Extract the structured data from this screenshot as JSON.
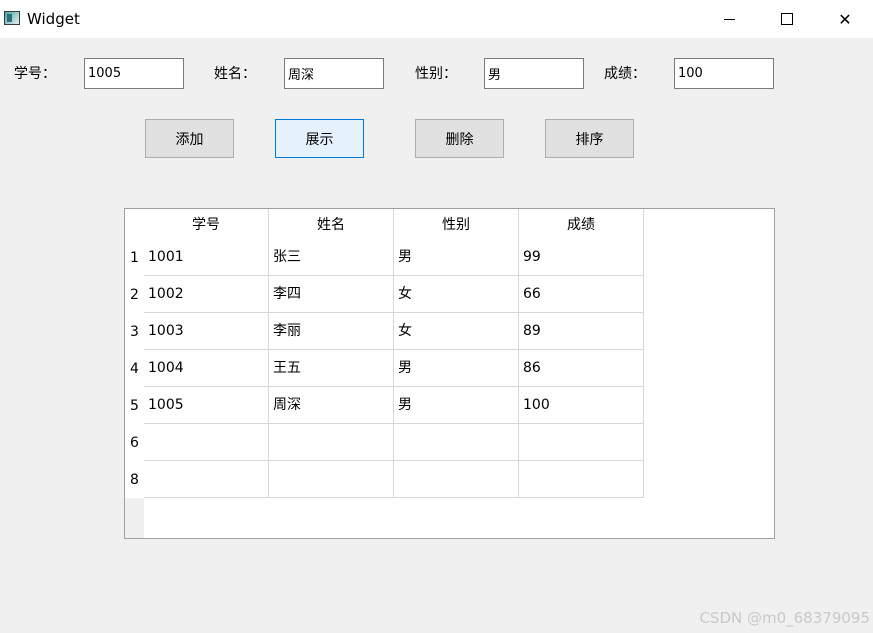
{
  "window": {
    "title": "Widget",
    "minimize_icon": "minimize-icon",
    "maximize_icon": "maximize-icon",
    "close_icon": "close-icon",
    "close_glyph": "✕"
  },
  "form": {
    "id_label": "学号：",
    "id_value": "1005",
    "name_label": "姓名：",
    "name_value": "周深",
    "gender_label": "性别：",
    "gender_value": "男",
    "score_label": "成绩：",
    "score_value": "100"
  },
  "buttons": {
    "add": "添加",
    "show": "展示",
    "delete": "删除",
    "sort": "排序"
  },
  "table": {
    "columns": [
      "学号",
      "姓名",
      "性别",
      "成绩"
    ],
    "row_headers": [
      "1",
      "2",
      "3",
      "4",
      "5",
      "6",
      "8"
    ],
    "rows": [
      [
        "1001",
        "张三",
        "男",
        "99"
      ],
      [
        "1002",
        "李四",
        "女",
        "66"
      ],
      [
        "1003",
        "李丽",
        "女",
        "89"
      ],
      [
        "1004",
        "王五",
        "男",
        "86"
      ],
      [
        "1005",
        "周深",
        "男",
        "100"
      ],
      [
        "",
        "",
        "",
        ""
      ],
      [
        "",
        "",
        "",
        ""
      ]
    ]
  },
  "watermark": "CSDN @m0_68379095",
  "colors": {
    "background": "#f0f0f0",
    "button_face": "#e1e1e1",
    "active_button_border": "#0078d7",
    "active_button_face": "#e5f1fb"
  }
}
